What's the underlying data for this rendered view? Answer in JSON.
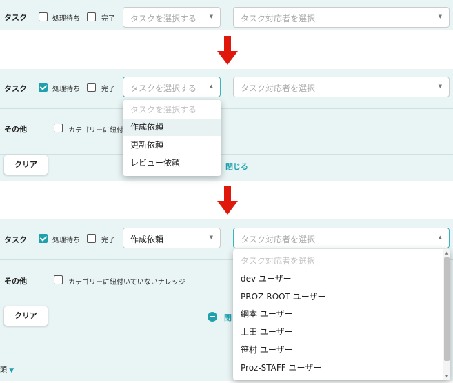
{
  "panel1": {
    "task_label": "タスク",
    "pending_label": "処理待ち",
    "pending_checked": false,
    "done_label": "完了",
    "done_checked": false,
    "task_select": {
      "text": "タスクを選択する"
    },
    "assignee_select": {
      "text": "タスク対応者を選択"
    }
  },
  "panel2": {
    "task_label": "タスク",
    "pending_label": "処理待ち",
    "pending_checked": true,
    "done_label": "完了",
    "done_checked": false,
    "task_select": {
      "text": "タスクを選択する",
      "open": true
    },
    "assignee_select": {
      "text": "タスク対応者を選択"
    },
    "other_label": "その他",
    "category_label": "カテゴリーに紐付",
    "clear_label": "クリア",
    "close_label": "閉じる",
    "dropdown": {
      "items": [
        "タスクを選択する",
        "作成依頼",
        "更新依頼",
        "レビュー依頼"
      ],
      "placeholder_index": 0,
      "highlight_index": 1
    }
  },
  "panel3": {
    "task_label": "タスク",
    "pending_label": "処理待ち",
    "pending_checked": true,
    "done_label": "完了",
    "done_checked": false,
    "task_select": {
      "text": "作成依頼"
    },
    "assignee_select": {
      "text": "タスク対応者を選択",
      "open": true
    },
    "other_label": "その他",
    "category_label": "カテゴリーに紐付いていないナレッジ",
    "clear_label": "クリア",
    "close_label": "閉",
    "cut_label": "頭",
    "dropdown": {
      "items": [
        "タスク対応者を選択",
        "dev ユーザー",
        "PROZ-ROOT ユーザー",
        "網本 ユーザー",
        "上田 ユーザー",
        "笹村 ユーザー",
        "Proz-STAFF ユーザー"
      ],
      "placeholder_index": 0
    }
  },
  "colors": {
    "accent": "#1fa1ad",
    "band": "#e9f4f4",
    "arrow": "#e0180c"
  },
  "icons": {
    "arrow": "red-down-arrow",
    "chevron": "chevron-down-icon",
    "minus": "minus-circle-icon"
  }
}
